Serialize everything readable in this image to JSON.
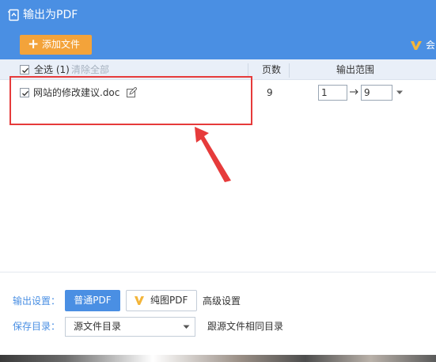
{
  "window": {
    "title": "输出为PDF",
    "add_file_label": "添加文件",
    "vip_label": "会",
    "icons": {
      "title": "pdf-export-icon",
      "vip": "vip-crown-icon"
    }
  },
  "table": {
    "select_all": "全选 (1)",
    "clear_all": "清除全部",
    "col_pages": "页数",
    "col_range": "输出范围",
    "rows": [
      {
        "checked": true,
        "name": "网站的修改建议.doc",
        "pages": "9",
        "range_from": "1",
        "range_to": "9"
      }
    ]
  },
  "settings": {
    "output_label": "输出设置：",
    "normal_pdf": "普通PDF",
    "image_pdf": "纯图PDF",
    "advanced": "高级设置",
    "save_label": "保存目录：",
    "save_dir": "源文件目录",
    "same_dir_note": "跟源文件相同目录"
  },
  "colors": {
    "accent": "#4a8fe3",
    "add_button": "#f3a33a",
    "annotation": "#e63b3b"
  }
}
